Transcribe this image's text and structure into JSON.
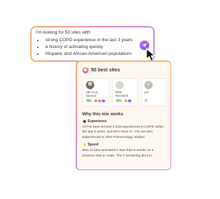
{
  "prompt": {
    "intro": "I'm looking for 50 sites with:",
    "bullets": [
      "strong COPD experience in the last 3 years",
      "a history of activating quickly",
      "Hispanic and African-American populations"
    ],
    "send_icon": "send-arrow-icon"
  },
  "results": {
    "title": "50 best sites",
    "sites": [
      {
        "name": "HB Crest General Hospital",
        "badge": "98%"
      },
      {
        "name": "PRR Research Center",
        "badge": "96%"
      },
      {
        "name": "LCI",
        "badge": "9"
      }
    ],
    "why_heading": "Why this mix works",
    "experience": {
      "title": "Experience",
      "text": "All PIs have at least 2 trial experiences in COPD within the last 3 years, and 50% have 3+. PIs are also experienced in other Pulmonology studies."
    },
    "speed": {
      "title": "Speed",
      "text": "96% of sites activated in less than 8 weeks on a previous trial on Inate. The 2 remaining did it in"
    }
  },
  "colors": {
    "accent_purple": "#8a4cf0",
    "gradient_orange": "#f3b15f",
    "gradient_pink": "#f087b0",
    "badge_green": "#2e8a3c"
  }
}
